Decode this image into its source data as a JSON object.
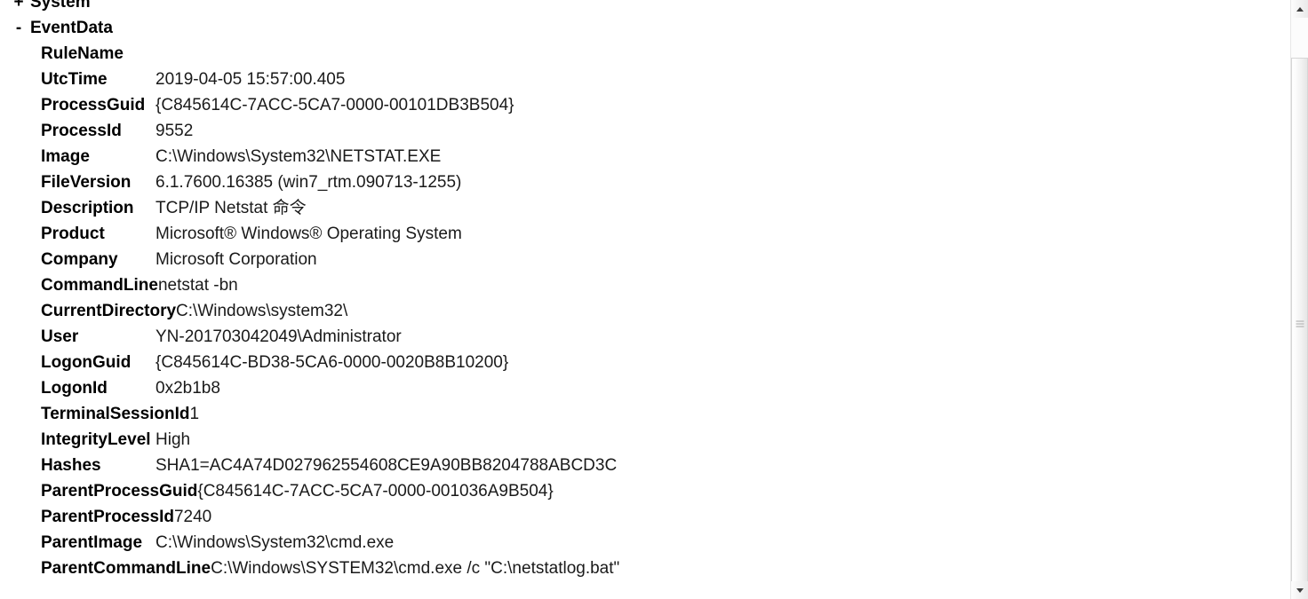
{
  "window": {
    "title": "EventData"
  },
  "tree": [
    {
      "toggle": "+",
      "label": "System",
      "expanded": false
    },
    {
      "toggle": "-",
      "label": "EventData",
      "expanded": true
    }
  ],
  "event_data": [
    {
      "key": "RuleName",
      "value": ""
    },
    {
      "key": "UtcTime",
      "value": "2019-04-05 15:57:00.405"
    },
    {
      "key": "ProcessGuid",
      "value": "{C845614C-7ACC-5CA7-0000-00101DB3B504}"
    },
    {
      "key": "ProcessId",
      "value": "9552"
    },
    {
      "key": "Image",
      "value": "C:\\Windows\\System32\\NETSTAT.EXE"
    },
    {
      "key": "FileVersion",
      "value": "6.1.7600.16385 (win7_rtm.090713-1255)"
    },
    {
      "key": "Description",
      "value": "TCP/IP Netstat 命令"
    },
    {
      "key": "Product",
      "value": "Microsoft® Windows® Operating System"
    },
    {
      "key": "Company",
      "value": "Microsoft Corporation"
    },
    {
      "key": "CommandLine",
      "value": "netstat -bn"
    },
    {
      "key": "CurrentDirectory",
      "value": "C:\\Windows\\system32\\"
    },
    {
      "key": "User",
      "value": "YN-201703042049\\Administrator"
    },
    {
      "key": "LogonGuid",
      "value": "{C845614C-BD38-5CA6-0000-0020B8B10200}"
    },
    {
      "key": "LogonId",
      "value": "0x2b1b8"
    },
    {
      "key": "TerminalSessionId",
      "value": "1"
    },
    {
      "key": "IntegrityLevel",
      "value": "High"
    },
    {
      "key": "Hashes",
      "value": "SHA1=AC4A74D027962554608CE9A90BB8204788ABCD3C"
    },
    {
      "key": "ParentProcessGuid",
      "value": "{C845614C-7ACC-5CA7-0000-001036A9B504}"
    },
    {
      "key": "ParentProcessId",
      "value": "7240"
    },
    {
      "key": "ParentImage",
      "value": "C:\\Windows\\System32\\cmd.exe"
    },
    {
      "key": "ParentCommandLine",
      "value": "C:\\Windows\\SYSTEM32\\cmd.exe /c \"C:\\netstatlog.bat\""
    }
  ],
  "scrollbar": {
    "up_icon": "scroll-up-arrow",
    "down_icon": "scroll-down-arrow"
  },
  "colors": {
    "background": "#ffffff",
    "key_text": "#000000",
    "value_text": "#1a1a1a",
    "scrollbar_border": "#d6d6d6"
  }
}
